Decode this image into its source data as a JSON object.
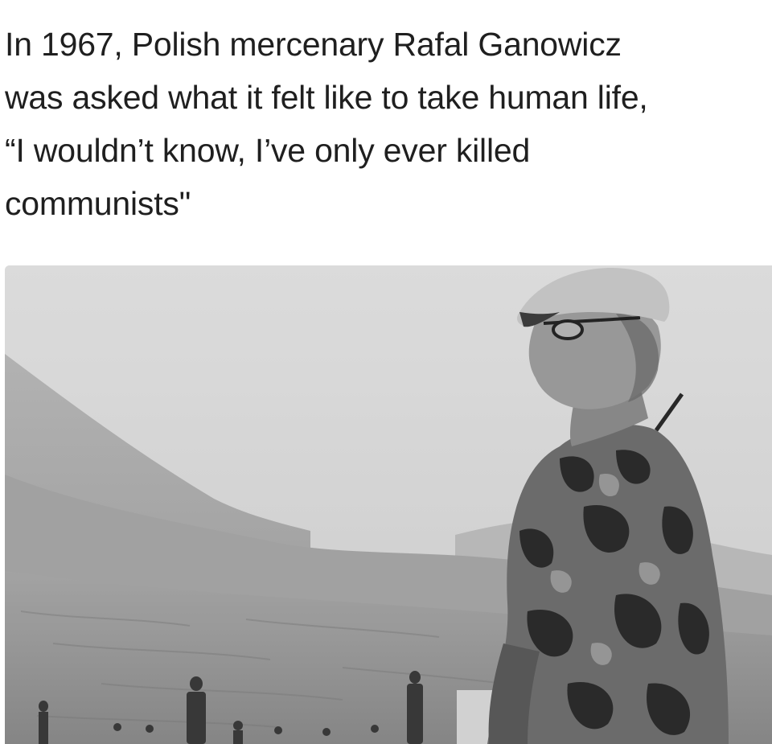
{
  "caption": {
    "lines": [
      "In 1967, Polish mercenary Rafal Ganowicz",
      "was asked what it felt like to take human life,",
      "“I wouldn’t know, I’ve only ever killed",
      "communists\""
    ]
  },
  "photo": {
    "style": "black-and-white",
    "subject": "soldier-in-camouflage-with-cap-and-glasses"
  }
}
